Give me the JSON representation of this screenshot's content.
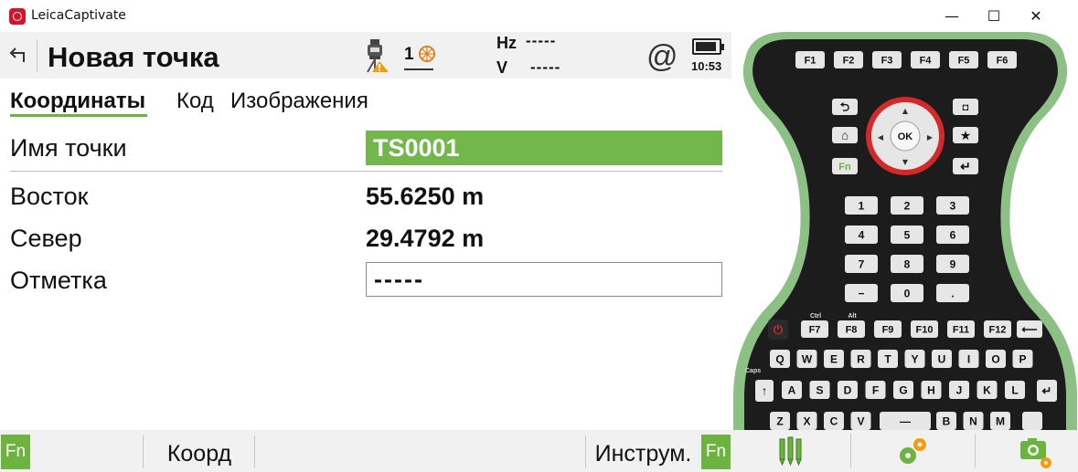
{
  "window": {
    "title": "LeicaCaptivate",
    "min_glyph": "—",
    "max_glyph": "☐",
    "close_glyph": "✕"
  },
  "header": {
    "title": "Новая точка",
    "target_number": "1",
    "hz_label": "Hz",
    "hz_value": "-----",
    "v_label": "V",
    "v_value": "-----",
    "connection_glyph": "@",
    "time": "10:53"
  },
  "tabs": [
    {
      "label": "Координаты",
      "active": true
    },
    {
      "label": "Код",
      "active": false
    },
    {
      "label": "Изображения",
      "active": false
    }
  ],
  "form": {
    "point_name": {
      "label": "Имя точки",
      "value": "TS0001"
    },
    "east": {
      "label": "Восток",
      "value": "55.6250 m"
    },
    "north": {
      "label": "Север",
      "value": "29.4792 m"
    },
    "elevation": {
      "label": "Отметка",
      "value": "-----"
    }
  },
  "softkeys": {
    "fn_label": "Fn",
    "coord_label": "Коорд",
    "tools_label": "Инструм."
  },
  "keypad": {
    "function_row": [
      "F1",
      "F2",
      "F3",
      "F4",
      "F5",
      "F6"
    ],
    "lower_function_row": [
      "F7",
      "F8",
      "F9",
      "F10",
      "F11",
      "F12"
    ],
    "modifier_labels": [
      "Ctrl",
      "Alt"
    ],
    "ok_label": "OK",
    "fn_label": "Fn",
    "numpad": [
      "1",
      "2",
      "3",
      "4",
      "5",
      "6",
      "7",
      "8",
      "9",
      "−",
      "0",
      "."
    ],
    "alpha_row1": [
      "Q",
      "W",
      "E",
      "R",
      "T",
      "Y",
      "U",
      "I",
      "O",
      "P"
    ],
    "alpha_row2": [
      "A",
      "S",
      "D",
      "F",
      "G",
      "H",
      "J",
      "K",
      "L"
    ],
    "alpha_row3": [
      "Z",
      "X",
      "C",
      "V",
      "B",
      "N",
      "M"
    ],
    "caps_label": "Caps",
    "colors": {
      "body": "#1c1c1c",
      "rim": "#8cc084",
      "key": "#e6e6e6",
      "ring": "#d22a2a",
      "accent": "#6cb33f"
    }
  },
  "icons": {
    "back": "back-arrow-icon",
    "instrument": "total-station-warning-icon",
    "target": "prism-target-icon",
    "battery": "battery-icon",
    "survey": "survey-pens-icon",
    "settings": "gears-icon",
    "camera": "camera-icon"
  }
}
